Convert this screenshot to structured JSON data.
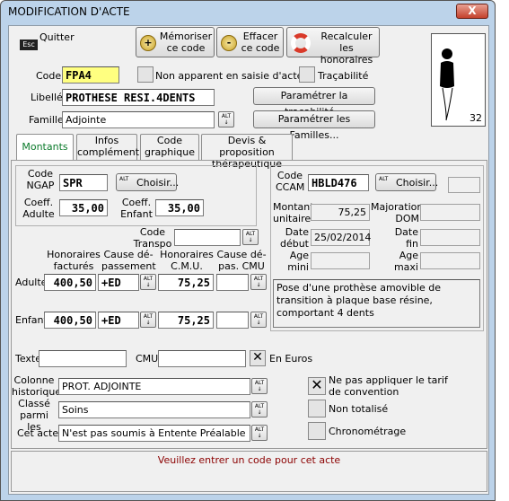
{
  "window": {
    "title": "MODIFICATION D'ACTE",
    "close_label": "X"
  },
  "toolbar": {
    "quit_label": "Quitter",
    "memorize_label": "Mémoriser ce code",
    "erase_label": "Effacer ce code",
    "recalc_label": "Recalculer les honoraires",
    "esc_label": "Esc",
    "plus_label": "+",
    "minus_label": "-"
  },
  "figure": {
    "count": "32"
  },
  "form": {
    "code_label": "Code",
    "code_value": "FPA4",
    "non_apparent_label": "Non apparent en saisie d'actes",
    "tracabilite_label": "Traçabilité",
    "libelle_label": "Libellé",
    "libelle_value": "PROTHESE RESI.4DENTS",
    "param_trac_label": "Paramétrer la traçabilité...",
    "famille_label": "Famille",
    "famille_value": "Adjointe",
    "param_fam_label": "Paramétrer les Familles..."
  },
  "alt_label": "ALT",
  "tabs": [
    {
      "label": "Montants"
    },
    {
      "label": "Infos complément."
    },
    {
      "label": "Code graphique"
    },
    {
      "label": "Devis & proposition thérapeutique"
    }
  ],
  "ngap": {
    "code_label": "Code NGAP",
    "code_value": "SPR",
    "choose_label": "Choisir...",
    "coeff_adulte_label": "Coeff. Adulte",
    "coeff_adulte_value": "35,00",
    "coeff_enfant_label": "Coeff. Enfant",
    "coeff_enfant_value": "35,00"
  },
  "ccam": {
    "code_label": "Code CCAM",
    "code_value": "HBLD476",
    "choose_label": "Choisir...",
    "montant_label": "Montant unitaire",
    "montant_value": "75,25",
    "majoration_label": "Majoration DOM",
    "date_debut_label": "Date début",
    "date_debut_value": "25/02/2014",
    "date_fin_label": "Date fin",
    "age_mini_label": "Age mini",
    "age_maxi_label": "Age maxi",
    "description": "Pose d'une prothèse amovible de transition à plaque base résine, comportant 4 dents"
  },
  "honoraires": {
    "code_transpo_label": "Code Transpo",
    "col_hon_fact": "Honoraires facturés",
    "col_cause_dep": "Cause dé- passement",
    "col_hon_cmu": "Honoraires C.M.U.",
    "col_cause_dep_cmu": "Cause dé- pas. CMU",
    "rows": [
      {
        "label": "Adulte",
        "hon_fact": "400,50",
        "cause": "+ED",
        "hon_cmu": "75,25",
        "cause_cmu": ""
      },
      {
        "label": "Enfant",
        "hon_fact": "400,50",
        "cause": "+ED",
        "hon_cmu": "75,25",
        "cause_cmu": ""
      }
    ]
  },
  "bottom": {
    "texte_label": "Texte",
    "cmu_label": "CMU",
    "en_euros_label": "En Euros",
    "colonne_label": "Colonne historique",
    "colonne_value": "PROT. ADJOINTE",
    "classe_label": "Classé parmi les",
    "classe_value": "Soins",
    "cet_acte_label": "Cet acte",
    "cet_acte_value": "N'est pas soumis à Entente Préalable",
    "ne_pas_appliquer_label": "Ne pas appliquer le tarif de convention",
    "non_totalise_label": "Non totalisé",
    "chrono_label": "Chronométrage"
  },
  "status": {
    "message": "Veuillez entrer un code pour cet acte"
  }
}
